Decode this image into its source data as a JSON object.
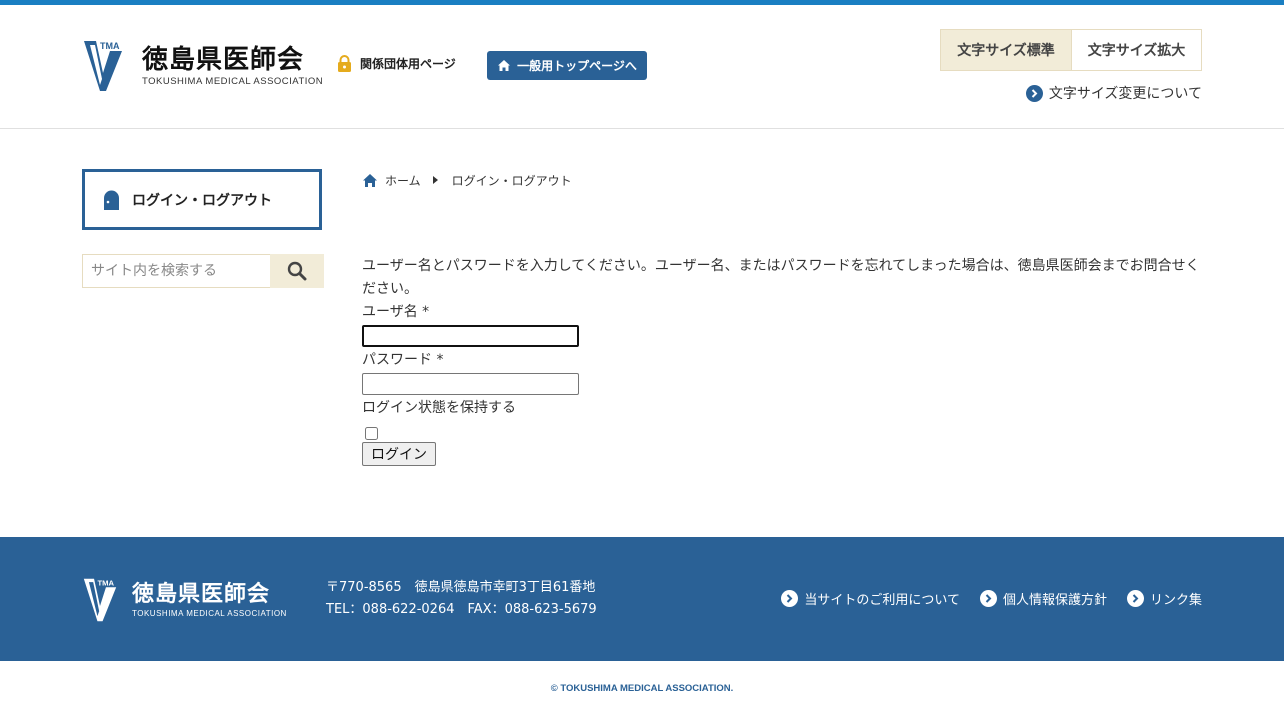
{
  "header": {
    "logo_name": "徳島県医師会",
    "logo_en": "TOKUSHIMA MEDICAL ASSOCIATION",
    "logo_mark_text": "TMA",
    "members_link": "関係団体用ページ",
    "general_top_button": "一般用トップページへ",
    "font_size_standard": "文字サイズ標準",
    "font_size_large": "文字サイズ拡大",
    "font_size_about": "文字サイズ変更について"
  },
  "sidebar": {
    "login_logout": "ログイン・ログアウト",
    "search_placeholder": "サイト内を検索する"
  },
  "breadcrumb": {
    "home": "ホーム",
    "current": "ログイン・ログアウト"
  },
  "content": {
    "intro": "ユーザー名とパスワードを入力してください。ユーザー名、またはパスワードを忘れてしまった場合は、徳島県医師会までお問合せください。",
    "username_label": "ユーザ名 *",
    "username_value": "",
    "password_label": "パスワード *",
    "password_value": "",
    "remember_label": "ログイン状態を保持する",
    "login_button": "ログイン"
  },
  "footer": {
    "logo_name": "徳島県医師会",
    "logo_en": "TOKUSHIMA MEDICAL ASSOCIATION",
    "address": "〒770-8565　徳島県徳島市幸町3丁目61番地",
    "phone": "TEL：088-622-0264　FAX：088-623-5679",
    "links": [
      "当サイトのご利用について",
      "個人情報保護方針",
      "リンク集"
    ],
    "copyright": "© TOKUSHIMA MEDICAL ASSOCIATION."
  },
  "colors": {
    "accent": "#2a6196",
    "top_bar": "#1a7fc2",
    "beige": "#f2ecd8",
    "lock": "#e5ab1d"
  }
}
